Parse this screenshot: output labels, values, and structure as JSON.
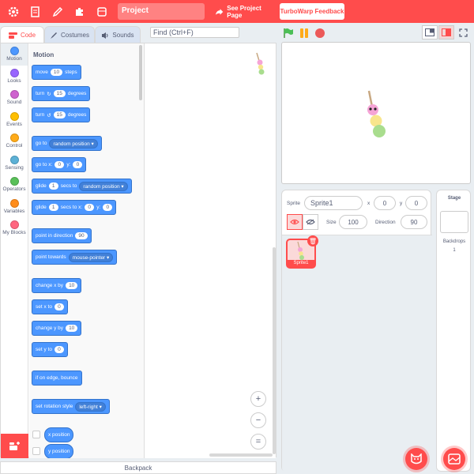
{
  "menubar": {
    "project_title": "Project",
    "see_project_page": "See Project Page",
    "feedback": "TurboWarp Feedback",
    "icons": [
      "gear-icon",
      "file-icon",
      "edit-icon",
      "puzzle-icon",
      "theme-icon"
    ]
  },
  "tabs": [
    {
      "label": "Code",
      "icon": "code-icon"
    },
    {
      "label": "Costumes",
      "icon": "brush-icon"
    },
    {
      "label": "Sounds",
      "icon": "speaker-icon"
    }
  ],
  "find": {
    "placeholder": "Find (Ctrl+F)"
  },
  "categories": [
    {
      "label": "Motion",
      "color": "#4c97ff"
    },
    {
      "label": "Looks",
      "color": "#9966ff"
    },
    {
      "label": "Sound",
      "color": "#cf63cf"
    },
    {
      "label": "Events",
      "color": "#ffbf00"
    },
    {
      "label": "Control",
      "color": "#ffab19"
    },
    {
      "label": "Sensing",
      "color": "#5cb1d6"
    },
    {
      "label": "Operators",
      "color": "#59c059"
    },
    {
      "label": "Variables",
      "color": "#ff8c1a"
    },
    {
      "label": "My Blocks",
      "color": "#ff6680"
    }
  ],
  "palette": {
    "title": "Motion",
    "move": {
      "a": "move",
      "v": "10",
      "b": "steps"
    },
    "turn_right": {
      "a": "turn",
      "v": "15",
      "b": "degrees"
    },
    "turn_left": {
      "a": "turn",
      "v": "15",
      "b": "degrees"
    },
    "goto": {
      "a": "go to",
      "dd": "random position"
    },
    "gotoxy": {
      "a": "go to x:",
      "x": "0",
      "b": "y:",
      "y": "0"
    },
    "glide_to": {
      "a": "glide",
      "v": "1",
      "b": "secs to",
      "dd": "random position"
    },
    "glide_xy": {
      "a": "glide",
      "v": "1",
      "b": "secs to x:",
      "x": "0",
      "c": "y:",
      "y": "0"
    },
    "point_dir": {
      "a": "point in direction",
      "v": "90"
    },
    "point_towards": {
      "a": "point towards",
      "dd": "mouse-pointer"
    },
    "change_x": {
      "a": "change x by",
      "v": "10"
    },
    "set_x": {
      "a": "set x to",
      "v": "0"
    },
    "change_y": {
      "a": "change y by",
      "v": "10"
    },
    "set_y": {
      "a": "set y to",
      "v": "0"
    },
    "bounce": {
      "a": "if on edge, bounce"
    },
    "rotation": {
      "a": "set rotation style",
      "dd": "left-right"
    },
    "x_position": "x position",
    "y_position": "y position"
  },
  "workspace": {
    "zoom": [
      "+",
      "−",
      "="
    ]
  },
  "backpack": "Backpack",
  "sprite_info": {
    "sprite_label": "Sprite",
    "sprite_name": "Sprite1",
    "x_label": "x",
    "x": "0",
    "y_label": "y",
    "y": "0",
    "size_label": "Size",
    "size": "100",
    "direction_label": "Direction",
    "direction": "90"
  },
  "sprites": [
    {
      "name": "Sprite1"
    }
  ],
  "stage_pane": {
    "title": "Stage",
    "backdrops_label": "Backdrops",
    "backdrops": "1"
  },
  "colors": {
    "accent": "#ff4c4c",
    "motion": "#4c97ff"
  }
}
